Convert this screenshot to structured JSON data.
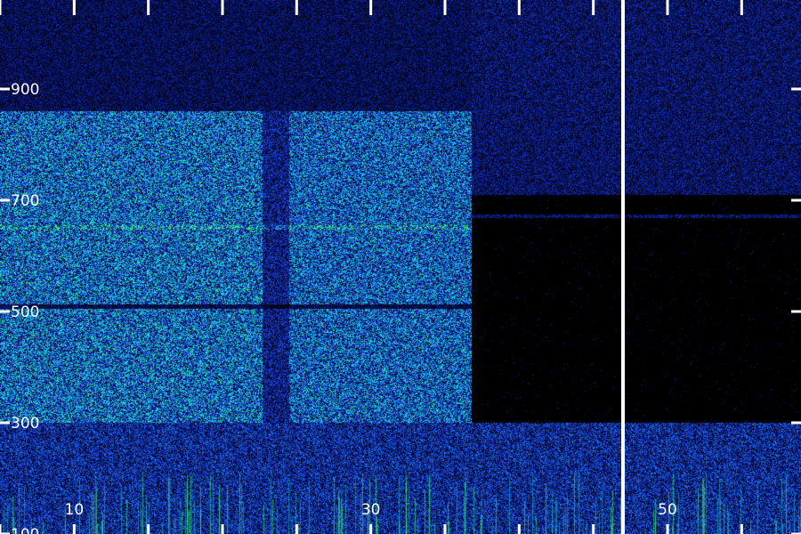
{
  "chart_data": {
    "type": "heatmap",
    "title": "",
    "xlabel": "",
    "ylabel": "",
    "xlim": [
      5,
      59
    ],
    "ylim": [
      100,
      1060
    ],
    "x_tick_labels": [
      "10",
      "30",
      "50"
    ],
    "x_label_ticks": [
      10,
      30,
      50
    ],
    "x_minor_ticks": [
      5,
      15,
      20,
      25,
      35,
      40,
      45,
      55
    ],
    "y_tick_labels": [
      "100",
      "300",
      "500",
      "700",
      "900"
    ],
    "y_ticks": [
      100,
      300,
      500,
      700,
      900
    ],
    "colormap": [
      "#000000",
      "#0a1a8c",
      "#1a4be0",
      "#1aa6f0",
      "#20e8c8",
      "#40ff60"
    ],
    "grid": false,
    "legend": "none",
    "vertical_marker": {
      "x": 47,
      "color": "#ffffff"
    },
    "regions": [
      {
        "name": "band-a",
        "x": [
          5,
          22.7
        ],
        "y": [
          300,
          860
        ],
        "intensity": 0.62
      },
      {
        "name": "gap",
        "x": [
          22.7,
          24.5
        ],
        "y": [
          300,
          860
        ],
        "intensity": 0.3
      },
      {
        "name": "band-b",
        "x": [
          24.5,
          36.8
        ],
        "y": [
          300,
          860
        ],
        "intensity": 0.58
      },
      {
        "name": "dead-zone",
        "x": [
          36.8,
          59
        ],
        "y": [
          290,
          710
        ],
        "intensity": 0.02
      },
      {
        "name": "upper-low",
        "x": [
          36.8,
          59
        ],
        "y": [
          710,
          1060
        ],
        "intensity": 0.22
      },
      {
        "name": "floor",
        "x": [
          5,
          59
        ],
        "y": [
          100,
          300
        ],
        "intensity": 0.36
      }
    ],
    "horizontal_lines": [
      {
        "y": 510,
        "x": [
          5,
          36.8
        ],
        "kind": "dark"
      },
      {
        "y": 652,
        "x": [
          5,
          36.8
        ],
        "kind": "bright"
      },
      {
        "y": 672,
        "x": [
          36.8,
          59
        ],
        "kind": "faint"
      }
    ]
  }
}
